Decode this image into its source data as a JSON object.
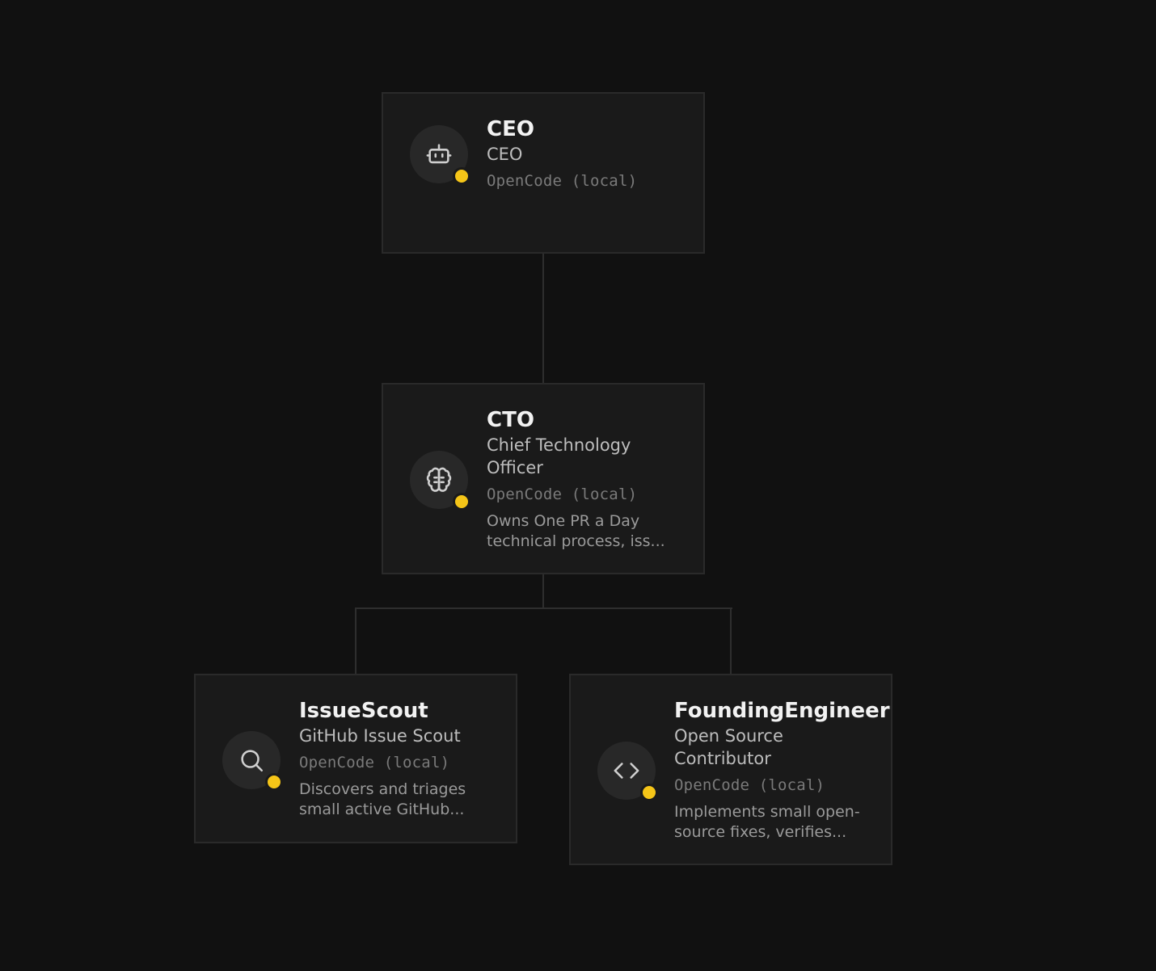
{
  "org_chart": {
    "nodes": [
      {
        "id": "ceo",
        "name": "CEO",
        "role": "CEO",
        "adapter": "OpenCode (local)",
        "description": "",
        "icon": "robot-icon",
        "status": "idle"
      },
      {
        "id": "cto",
        "name": "CTO",
        "role": "Chief Technology Officer",
        "adapter": "OpenCode (local)",
        "description": "Owns One PR a Day technical process, iss...",
        "icon": "brain-icon",
        "status": "idle"
      },
      {
        "id": "issuescout",
        "name": "IssueScout",
        "role": "GitHub Issue Scout",
        "adapter": "OpenCode (local)",
        "description": "Discovers and triages small active GitHub...",
        "icon": "search-icon",
        "status": "idle"
      },
      {
        "id": "foundingengineer",
        "name": "FoundingEngineer",
        "role": "Open Source Contributor",
        "adapter": "OpenCode (local)",
        "description": "Implements small open-source fixes, verifies...",
        "icon": "code-icon",
        "status": "idle"
      }
    ],
    "colors": {
      "background": "#111111",
      "card": "#1a1a1a",
      "card_border": "#2a2a2a",
      "connector": "#2e2e2e",
      "status_dot": "#f5c518",
      "name_text": "#f2f2f2",
      "role_text": "#bdbdbd",
      "adapter_text": "#7a7a7a",
      "description_text": "#9a9a9a"
    }
  }
}
